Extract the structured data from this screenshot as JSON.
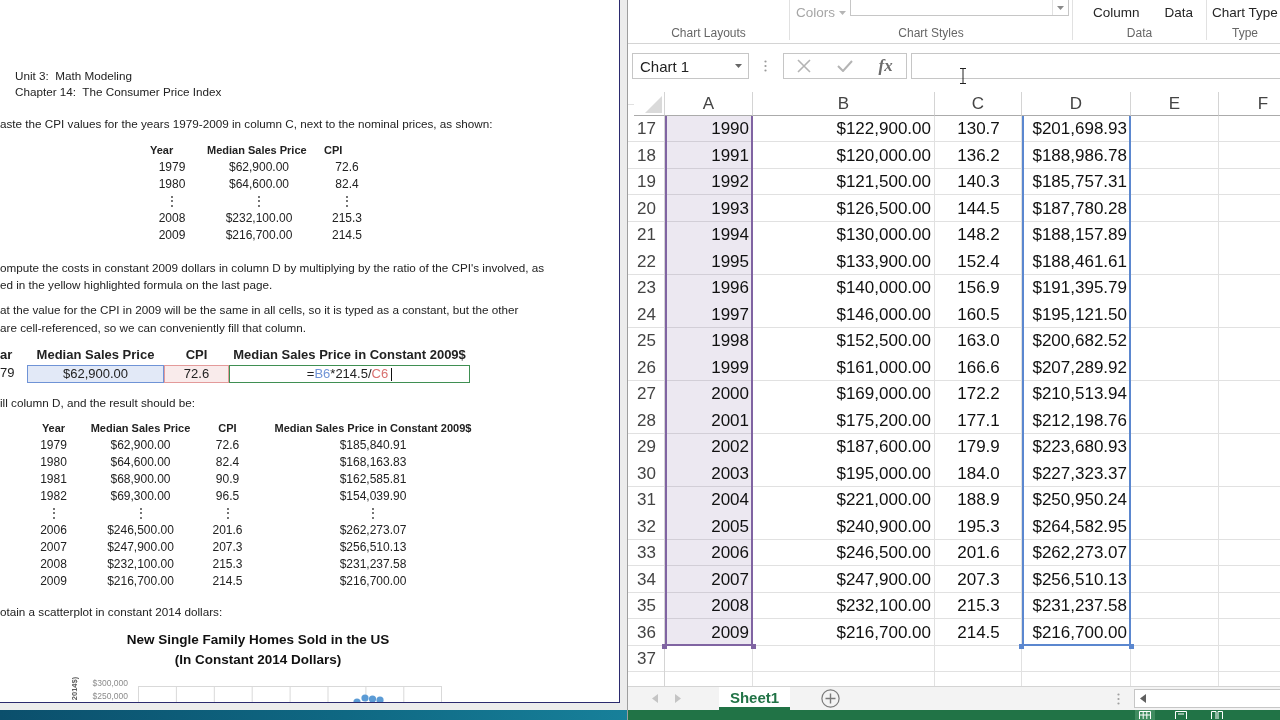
{
  "document": {
    "heading_lines": [
      "Unit 3:  Math Modeling",
      "Chapter 14:  The Consumer Price Index"
    ],
    "intro_text": "aste the CPI values for the years 1979-2009 in column C, next to the nominal prices, as shown:",
    "cpi_table": {
      "columns": [
        "Year",
        "Median Sales Price",
        "CPI"
      ],
      "rows": [
        [
          "1979",
          "$62,900.00",
          "72.6"
        ],
        [
          "1980",
          "$64,600.00",
          "82.4"
        ],
        [
          "⋮",
          "⋮",
          "⋮"
        ],
        [
          "2008",
          "$232,100.00",
          "215.3"
        ],
        [
          "2009",
          "$216,700.00",
          "214.5"
        ]
      ]
    },
    "compute_text_lines": [
      "ompute the costs in constant 2009 dollars in column D by multiplying by the ratio of the CPI's involved, as",
      "ed in the yellow highlighted formula on the last page."
    ],
    "note_text_lines": [
      "at the value for the CPI in 2009 will be the same in all cells, so it is typed as a constant, but the other",
      "are cell-referenced, so we can conveniently fill that column."
    ],
    "formula_example": {
      "columns": [
        "ar",
        "Median Sales Price",
        "CPI",
        "Median Sales Price in Constant 2009$"
      ],
      "cells": [
        {
          "text": "79"
        },
        {
          "text": "$62,900.00",
          "color": "#6f93d6"
        },
        {
          "text": "72.6",
          "color": "#e39a9a"
        },
        {
          "color": "#3f8f52",
          "editing": true,
          "parts": [
            {
              "kind": "plain",
              "text": "="
            },
            {
              "kind": "ref",
              "text": "B6",
              "color": "#6f93d6"
            },
            {
              "kind": "plain",
              "text": "*214.5/"
            },
            {
              "kind": "ref",
              "text": "C6",
              "color": "#d9706f"
            }
          ]
        }
      ]
    },
    "fill_text": "ill column D, and the result should be:",
    "result_table": {
      "columns": [
        "Year",
        "Median Sales Price",
        "CPI",
        "Median Sales Price in Constant 2009$"
      ],
      "rows": [
        [
          "1979",
          "$62,900.00",
          "72.6",
          "$185,840.91"
        ],
        [
          "1980",
          "$64,600.00",
          "82.4",
          "$168,163.83"
        ],
        [
          "1981",
          "$68,900.00",
          "90.9",
          "$162,585.81"
        ],
        [
          "1982",
          "$69,300.00",
          "96.5",
          "$154,039.90"
        ],
        [
          "⋮",
          "⋮",
          "⋮",
          "⋮"
        ],
        [
          "2006",
          "$246,500.00",
          "201.6",
          "$262,273.07"
        ],
        [
          "2007",
          "$247,900.00",
          "207.3",
          "$256,510.13"
        ],
        [
          "2008",
          "$232,100.00",
          "215.3",
          "$231,237.58"
        ],
        [
          "2009",
          "$216,700.00",
          "214.5",
          "$216,700.00"
        ]
      ]
    },
    "scatter_text": "otain a scatterplot in constant 2014 dollars:",
    "chart": {
      "title_lines": [
        "New Single Family Homes Sold in the US",
        "(In Constant 2014 Dollars)"
      ],
      "axis_label": "2014$)",
      "tick_labels": [
        "$300,000",
        "$250,000"
      ]
    }
  },
  "excel": {
    "ribbon": {
      "groups": [
        {
          "label": "Chart Layouts"
        },
        {
          "label": "Chart Styles",
          "items": [
            {
              "kind": "dropdown",
              "label": "Colors",
              "disabled": true
            },
            {
              "kind": "gallery"
            }
          ]
        },
        {
          "label": "Data",
          "items": [
            {
              "kind": "button",
              "label": "Column",
              "disabled": false
            },
            {
              "kind": "button",
              "label": "Data",
              "disabled": false
            }
          ]
        },
        {
          "label": "Type",
          "items": [
            {
              "kind": "button",
              "label": "Chart Type",
              "disabled": false
            }
          ]
        }
      ]
    },
    "name_box": "Chart 1",
    "function_label": "fx",
    "columns": [
      {
        "label": "A",
        "range": {
          "color": "#8064a2",
          "shaded": true
        }
      },
      {
        "label": "B"
      },
      {
        "label": "C"
      },
      {
        "label": "D",
        "range": {
          "color": "#5b87cf",
          "shaded": false
        }
      },
      {
        "label": "E"
      },
      {
        "label": "F"
      }
    ],
    "rows": [
      {
        "number": "17",
        "cells": [
          "1990",
          "$122,900.00",
          "130.7",
          "$201,698.93"
        ]
      },
      {
        "number": "18",
        "cells": [
          "1991",
          "$120,000.00",
          "136.2",
          "$188,986.78"
        ]
      },
      {
        "number": "19",
        "cells": [
          "1992",
          "$121,500.00",
          "140.3",
          "$185,757.31"
        ]
      },
      {
        "number": "20",
        "cells": [
          "1993",
          "$126,500.00",
          "144.5",
          "$187,780.28"
        ]
      },
      {
        "number": "21",
        "cells": [
          "1994",
          "$130,000.00",
          "148.2",
          "$188,157.89"
        ]
      },
      {
        "number": "22",
        "cells": [
          "1995",
          "$133,900.00",
          "152.4",
          "$188,461.61"
        ]
      },
      {
        "number": "23",
        "cells": [
          "1996",
          "$140,000.00",
          "156.9",
          "$191,395.79"
        ]
      },
      {
        "number": "24",
        "cells": [
          "1997",
          "$146,000.00",
          "160.5",
          "$195,121.50"
        ]
      },
      {
        "number": "25",
        "cells": [
          "1998",
          "$152,500.00",
          "163.0",
          "$200,682.52"
        ]
      },
      {
        "number": "26",
        "cells": [
          "1999",
          "$161,000.00",
          "166.6",
          "$207,289.92"
        ]
      },
      {
        "number": "27",
        "cells": [
          "2000",
          "$169,000.00",
          "172.2",
          "$210,513.94"
        ]
      },
      {
        "number": "28",
        "cells": [
          "2001",
          "$175,200.00",
          "177.1",
          "$212,198.76"
        ]
      },
      {
        "number": "29",
        "cells": [
          "2002",
          "$187,600.00",
          "179.9",
          "$223,680.93"
        ]
      },
      {
        "number": "30",
        "cells": [
          "2003",
          "$195,000.00",
          "184.0",
          "$227,323.37"
        ]
      },
      {
        "number": "31",
        "cells": [
          "2004",
          "$221,000.00",
          "188.9",
          "$250,950.24"
        ]
      },
      {
        "number": "32",
        "cells": [
          "2005",
          "$240,900.00",
          "195.3",
          "$264,582.95"
        ]
      },
      {
        "number": "33",
        "cells": [
          "2006",
          "$246,500.00",
          "201.6",
          "$262,273.07"
        ]
      },
      {
        "number": "34",
        "cells": [
          "2007",
          "$247,900.00",
          "207.3",
          "$256,510.13"
        ]
      },
      {
        "number": "35",
        "cells": [
          "2008",
          "$232,100.00",
          "215.3",
          "$231,237.58"
        ]
      },
      {
        "number": "36",
        "cells": [
          "2009",
          "$216,700.00",
          "214.5",
          "$216,700.00"
        ]
      },
      {
        "number": "37"
      }
    ],
    "sheet_tabs": [
      {
        "label": "Sheet1",
        "selected": true
      }
    ],
    "status_bar": {
      "view_buttons": [
        {
          "kind": "normal",
          "selected": true
        },
        {
          "kind": "page_layout",
          "selected": false
        },
        {
          "kind": "page_break",
          "selected": false
        }
      ]
    }
  }
}
